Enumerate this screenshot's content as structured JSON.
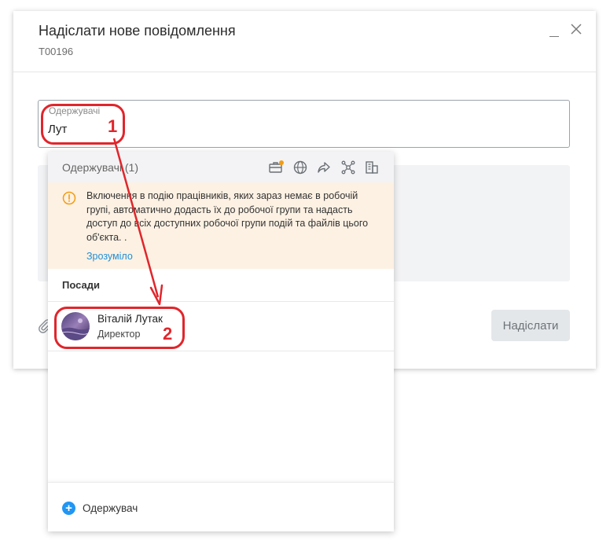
{
  "dialog": {
    "title": "Надіслати нове повідомлення",
    "subtitle": "T00196",
    "minimize_icon": "minimize-icon",
    "close_icon": "close-icon"
  },
  "recipients": {
    "label": "Одержувачі",
    "value": "Лут"
  },
  "composer": {
    "attach_icon": "paperclip-icon",
    "send_label": "Надіслати"
  },
  "popup": {
    "header_title": "Одержувачі (1)",
    "header_icons": [
      "briefcase-icon",
      "globe-icon",
      "share-arrow-icon",
      "network-icon",
      "building-icon"
    ],
    "notice": {
      "text": "Включення в подію працівників, яких зараз немає в робочій групі, автоматично додасть їх до робочої групи та надасть доступ до всіх доступних робочої групи подій та файлів цього об'єкта. .",
      "link": "Зрозуміло"
    },
    "section_title": "Посади",
    "person": {
      "name": "Віталій Лутак",
      "role": "Директор"
    },
    "footer_add_label": "Одержувач"
  },
  "annotations": {
    "label_1": "1",
    "label_2": "2",
    "color": "#e0262c"
  },
  "colors": {
    "accent": "#2196f3",
    "link": "#1f8fd6",
    "notice_bg": "#fdf1e3",
    "warning": "#f39c12"
  }
}
